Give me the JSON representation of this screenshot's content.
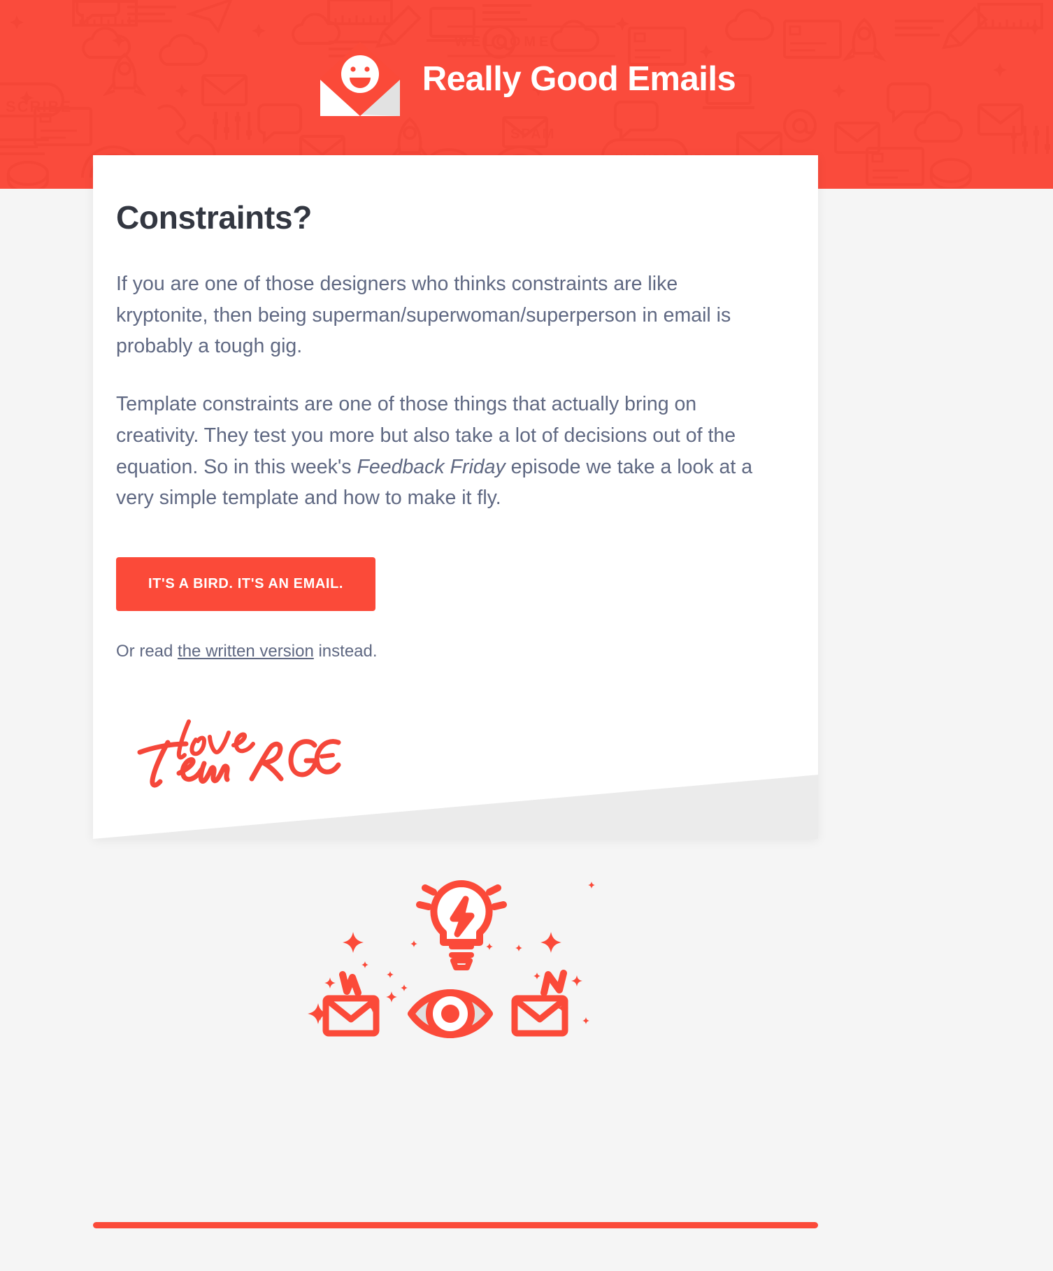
{
  "header": {
    "brand_name": "Really Good Emails",
    "logo_icon": "envelope-smiley-icon",
    "background_color": "#fa4b3c",
    "pattern_icons": [
      "envelope",
      "cloud",
      "rocket",
      "rainbow",
      "bell",
      "paper-plane",
      "at-sign",
      "keyboard",
      "pencil",
      "megaphone",
      "coin",
      "chat-bubble",
      "laptop",
      "spam",
      "welcome",
      "unsubscribe",
      "subscribe",
      "sparkle"
    ]
  },
  "card": {
    "title": "Constraints?",
    "paragraphs": [
      {
        "id": "p1",
        "segments": [
          {
            "text": "If you are one of those designers who thinks constraints are like kryptonite, then being superman/superwoman/superperson in email is probably a tough gig.",
            "style": "normal"
          }
        ]
      },
      {
        "id": "p2",
        "segments": [
          {
            "text": "Template constraints are one of those things that actually bring on creativity. They test you more but also take a lot of decisions out of the equation. So in this week's ",
            "style": "normal"
          },
          {
            "text": "Feedback Friday",
            "style": "italic"
          },
          {
            "text": " episode we take a look at a very simple template and how to make it fly.",
            "style": "normal"
          }
        ]
      }
    ],
    "cta_label": "IT'S A BIRD. IT'S AN EMAIL.",
    "read_prefix": "Or read ",
    "read_link_label": "the written version",
    "read_suffix": " instead.",
    "signature_text": "Love Team RGE"
  },
  "illustration": {
    "name": "lightbulb-eye-envelopes-illustration",
    "elements": [
      "lightbulb-icon",
      "lightning-bolt-icon",
      "eye-icon",
      "envelope-icon",
      "sparkle-icon",
      "zigzag-icon"
    ]
  },
  "colors": {
    "brand_red": "#fb4a39",
    "header_red": "#fa4b3c",
    "heading_dark": "#333741",
    "body_text": "#5f6882",
    "page_background": "#f5f5f5",
    "card_background": "#ffffff",
    "card_fold": "#ebebeb"
  }
}
